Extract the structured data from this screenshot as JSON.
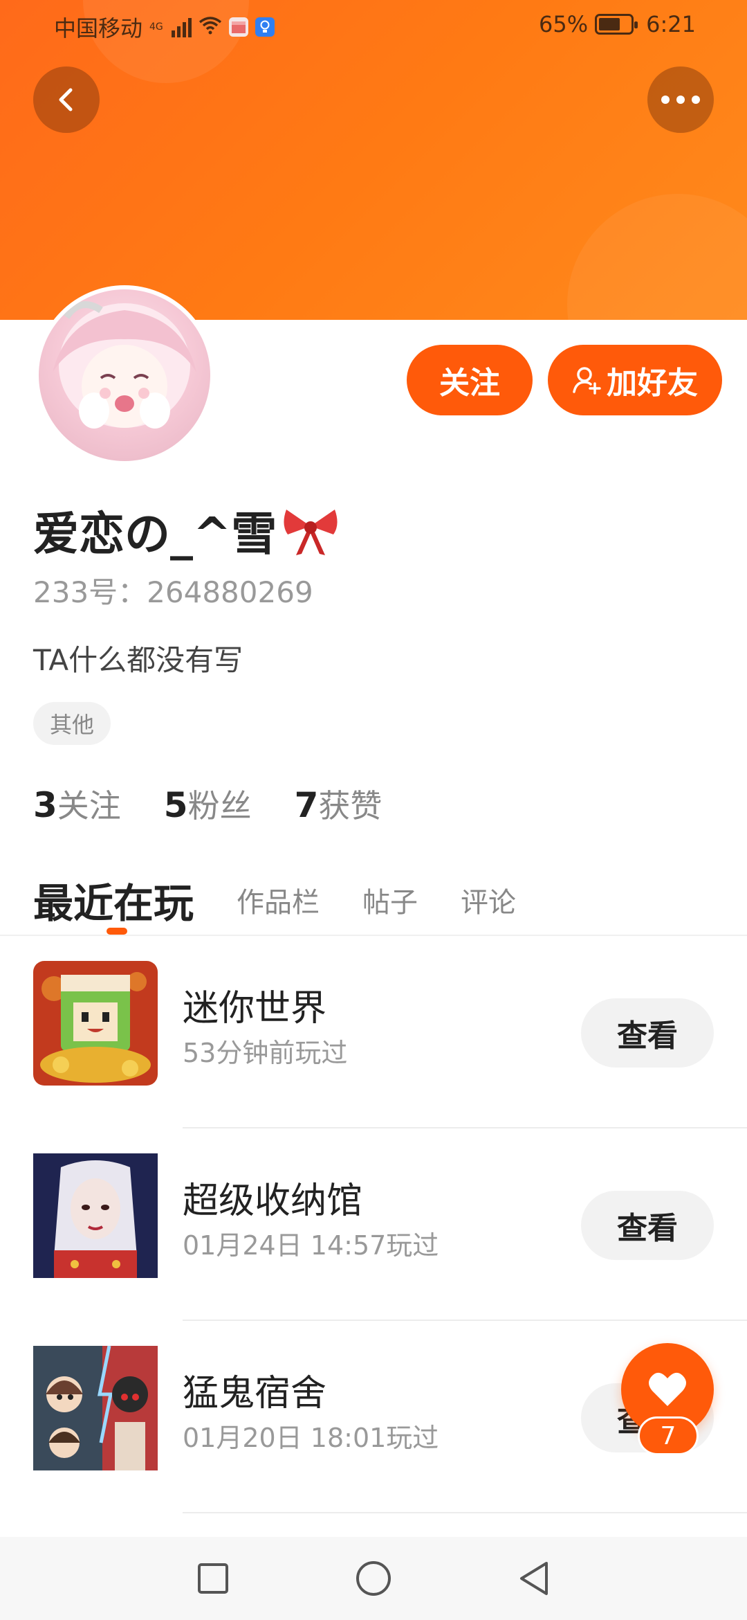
{
  "status_bar": {
    "carrier": "中国移动",
    "network": "4G",
    "battery": "65%",
    "time": "6:21"
  },
  "header": {
    "back_icon": "chevron-left-icon",
    "more_icon": "more-horizontal-icon"
  },
  "profile": {
    "name": "爱恋の_^雪",
    "uid": "233号：264880269",
    "bio": "TA什么都没有写",
    "tag": "其他",
    "follow_label": "关注",
    "add_friend_label": "加好友"
  },
  "stats": [
    {
      "num": "3",
      "label": "关注"
    },
    {
      "num": "5",
      "label": "粉丝"
    },
    {
      "num": "7",
      "label": "获赞"
    }
  ],
  "tabs": [
    {
      "label": "最近在玩",
      "active": true
    },
    {
      "label": "作品栏",
      "active": false
    },
    {
      "label": "帖子",
      "active": false
    },
    {
      "label": "评论",
      "active": false
    }
  ],
  "games": [
    {
      "title": "迷你世界",
      "sub": "53分钟前玩过",
      "button": "查看"
    },
    {
      "title": "超级收纳馆",
      "sub": "01月24日 14:57玩过",
      "button": "查看"
    },
    {
      "title": "猛鬼宿舍",
      "sub": "01月20日 18:01玩过",
      "button": "查看"
    }
  ],
  "fab": {
    "count": "7",
    "icon": "heart-icon"
  },
  "colors": {
    "accent": "#ff5a0a",
    "banner": "#ff7a14"
  }
}
